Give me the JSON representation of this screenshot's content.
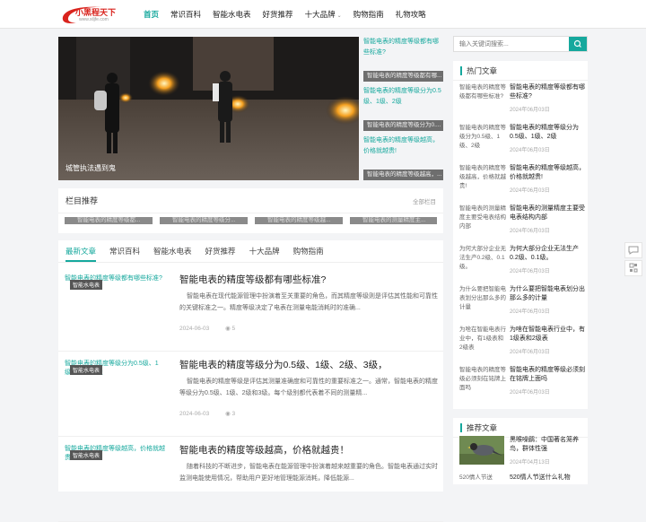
{
  "logo": {
    "title": "小黑程天下",
    "subtitle": "www.xiljfe.com"
  },
  "nav": [
    {
      "label": "首页",
      "active": true
    },
    {
      "label": "常识百科",
      "active": false
    },
    {
      "label": "智能水电表",
      "active": false
    },
    {
      "label": "好货推荐",
      "active": false
    },
    {
      "label": "十大品牌",
      "active": false,
      "dropdown": true
    },
    {
      "label": "购物指南",
      "active": false
    },
    {
      "label": "礼物攻略",
      "active": false
    }
  ],
  "slider": {
    "caption": "城管执法遇到鬼"
  },
  "side_thumbs": [
    {
      "alt": "智能电表的精度等级都有哪些标准?",
      "bar": "智能电表的精度等级都有哪..."
    },
    {
      "alt": "智能电表的精度等级分为0.5级、1级、2级",
      "bar": "智能电表的精度等级分为0...."
    },
    {
      "alt": "智能电表的精度等级越高，价格就越贵!",
      "bar": "智能电表的精度等级越高，..."
    }
  ],
  "recommend": {
    "title": "栏目推荐",
    "all_link": "全部栏目",
    "items": [
      "智能电表的精度等级都...",
      "智能电表的精度等级分...",
      "智能电表的精度等级越...",
      "智能电表的测量精度主..."
    ]
  },
  "tabs": [
    {
      "label": "最新文章",
      "active": true
    },
    {
      "label": "常识百科",
      "active": false
    },
    {
      "label": "智能水电表",
      "active": false
    },
    {
      "label": "好货推荐",
      "active": false
    },
    {
      "label": "十大品牌",
      "active": false
    },
    {
      "label": "购物指南",
      "active": false
    }
  ],
  "posts": [
    {
      "thumb_alt": "智能电表的精度等级都有哪些标准?",
      "badge": "智能水电表",
      "title": "智能电表的精度等级都有哪些标准?",
      "excerpt": "智能电表在现代能源管理中扮演着至关重要的角色，而其精度等级则是评估其性能和可靠性的关键标准之一。精度等级决定了电表在测量电能消耗时的准确...",
      "date": "2024-06-03",
      "views": "5"
    },
    {
      "thumb_alt": "智能电表的精度等级分为0.5级、1级、2级、3级",
      "badge": "智能水电表",
      "title": "智能电表的精度等级分为0.5级、1级、2级、3级，",
      "excerpt": "智能电表的精度等级是评估其测量准确度和可靠性的重要标准之一。通常，智能电表的精度等级分为0.5级、1级、2级和3级。每个级别都代表着不同的测量精...",
      "date": "2024-06-03",
      "views": "3"
    },
    {
      "thumb_alt": "智能电表的精度等级越高，价格就越贵",
      "badge": "智能水电表",
      "title": "智能电表的精度等级越高，价格就越贵！",
      "excerpt": "随着科技的不断进步，智能电表在能源管理中扮演着越来越重要的角色。智能电表通过实时监测电能使用情况，帮助用户更好地管理能源消耗，降低能源...",
      "date": "2024-06-03",
      "views": ""
    }
  ],
  "search": {
    "placeholder": "输入关键词搜索..."
  },
  "hot": {
    "title": "热门文章",
    "items": [
      {
        "thumb": "智能电表的精度等级都有哪些标准?",
        "title": "智能电表的精度等级都有哪些标准?",
        "date": "2024年06月03日"
      },
      {
        "thumb": "智能电表的精度等级分为0.5级、1级、2级",
        "title": "智能电表的精度等级分为0.5级、1级、2级",
        "date": "2024年06月03日"
      },
      {
        "thumb": "智能电表的精度等级越高，价格就越贵!",
        "title": "智能电表的精度等级越高，价格就越贵!",
        "date": "2024年06月03日"
      },
      {
        "thumb": "智能电表的测量精度主要受电表结构内部",
        "title": "智能电表的测量精度主要受电表结构内部",
        "date": "2024年06月03日"
      },
      {
        "thumb": "为何大部分企业无法生产0.2级、0.1级。",
        "title": "为何大部分企业无法生产0.2级、0.1级。",
        "date": "2024年06月03日"
      },
      {
        "thumb": "为什么要把智能电表划分出那么多的计量",
        "title": "为什么要把智能电表划分出那么多的计量",
        "date": "2024年06月03日"
      },
      {
        "thumb": "为啥在智能电表行业中，有1级表和2级表",
        "title": "为啥在智能电表行业中，有1级表和2级表",
        "date": "2024年06月03日"
      },
      {
        "thumb": "智能电表的精度等级必须刻在铭牌上面吗",
        "title": "智能电表的精度等级必须刻在铭牌上面吗",
        "date": "2024年06月03日"
      }
    ]
  },
  "recommended": {
    "title": "推荐文章",
    "items": [
      {
        "title": "黑喉噪鹛：中国著名笼养鸟，群体性强",
        "date": "2024年04月13日"
      },
      {
        "thumb": "520情人节送",
        "title": "520情人节送什么礼物",
        "date": ""
      }
    ]
  }
}
